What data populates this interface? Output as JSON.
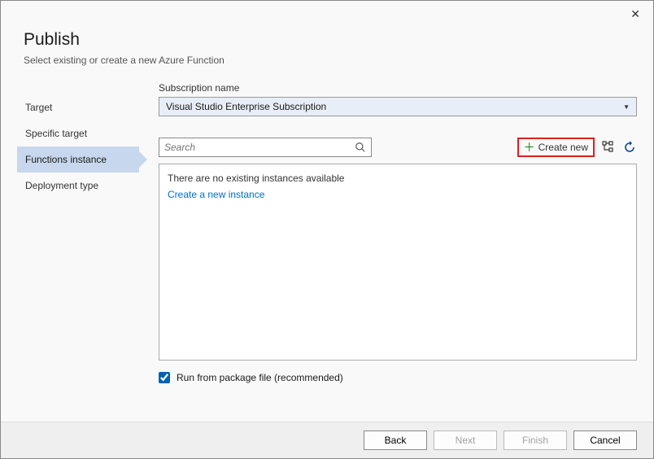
{
  "header": {
    "title": "Publish",
    "subtitle": "Select existing or create a new Azure Function"
  },
  "sidebar": {
    "items": [
      {
        "label": "Target"
      },
      {
        "label": "Specific target"
      },
      {
        "label": "Functions instance"
      },
      {
        "label": "Deployment type"
      }
    ],
    "active_index": 2
  },
  "subscription": {
    "label": "Subscription name",
    "value": "Visual Studio Enterprise Subscription"
  },
  "search": {
    "placeholder": "Search"
  },
  "toolbar": {
    "create_new": "Create new"
  },
  "instances": {
    "empty_message": "There are no existing instances available",
    "create_link": "Create a new instance"
  },
  "run_from_package": {
    "label": "Run from package file (recommended)",
    "checked": true
  },
  "footer": {
    "back": "Back",
    "next": "Next",
    "finish": "Finish",
    "cancel": "Cancel"
  }
}
